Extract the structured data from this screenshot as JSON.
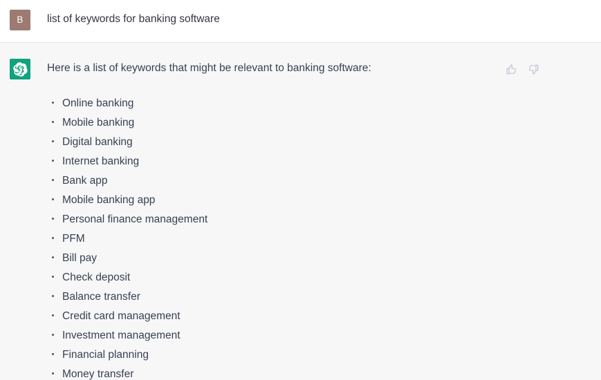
{
  "colors": {
    "user_row_bg": "#ffffff",
    "assistant_row_bg": "#f7f7f8",
    "divider": "#e5e5e6",
    "user_avatar_bg": "#9c7b72",
    "assistant_avatar_bg": "#10a37f",
    "text": "#374151",
    "feedback_icon": "#c3c3d1"
  },
  "user_message": {
    "avatar_initial": "B",
    "avatar_name": "user-avatar",
    "text": "list of keywords for banking software"
  },
  "assistant_message": {
    "avatar_icon": "openai-logo-icon",
    "intro": "Here is a list of keywords that might be relevant to banking software:",
    "keywords": [
      "Online banking",
      "Mobile banking",
      "Digital banking",
      "Internet banking",
      "Bank app",
      "Mobile banking app",
      "Personal finance management",
      "PFM",
      "Bill pay",
      "Check deposit",
      "Balance transfer",
      "Credit card management",
      "Investment management",
      "Financial planning",
      "Money transfer"
    ],
    "feedback": {
      "thumbs_up_icon": "thumbs-up-icon",
      "thumbs_down_icon": "thumbs-down-icon"
    }
  }
}
